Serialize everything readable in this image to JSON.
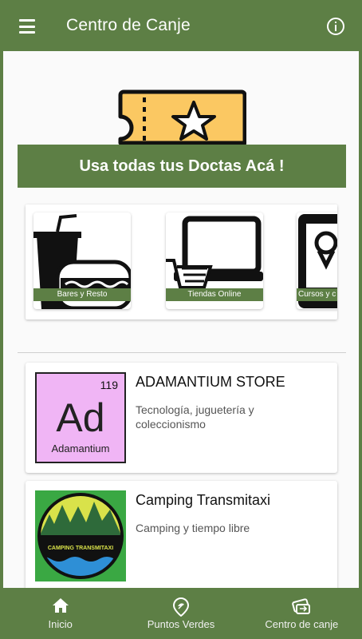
{
  "app_bar": {
    "title": "Centro de Canje",
    "menu_icon": "menu-icon",
    "info_icon": "info-icon"
  },
  "hero": {
    "ticket_icon": "ticket-star-icon",
    "banner": "Usa todas tus Doctas Acá !"
  },
  "categories": [
    {
      "label": "Bares y Resto",
      "icon": "food-drink-icon"
    },
    {
      "label": "Tiendas Online",
      "icon": "laptop-cart-icon"
    },
    {
      "label": "Cursos y c",
      "icon": "phone-location-icon"
    }
  ],
  "stores": [
    {
      "name": "ADAMANTIUM STORE",
      "description": "Tecnología, juguetería y coleccionismo",
      "logo": {
        "number": "119",
        "symbol": "Ad",
        "element": "Adamantium"
      }
    },
    {
      "name": "Camping Transmitaxi",
      "description": "Camping y tiempo libre",
      "logo": {
        "text": "CAMPING TRANSMITAXI"
      }
    }
  ],
  "bottom_nav": [
    {
      "label": "Inicio",
      "icon": "home-icon"
    },
    {
      "label": "Puntos Verdes",
      "icon": "map-pin-icon"
    },
    {
      "label": "Centro de canje",
      "icon": "exchange-icon"
    }
  ],
  "colors": {
    "primary": "#5d7f45",
    "background": "#fafafa",
    "ticket": "#fbc862"
  }
}
